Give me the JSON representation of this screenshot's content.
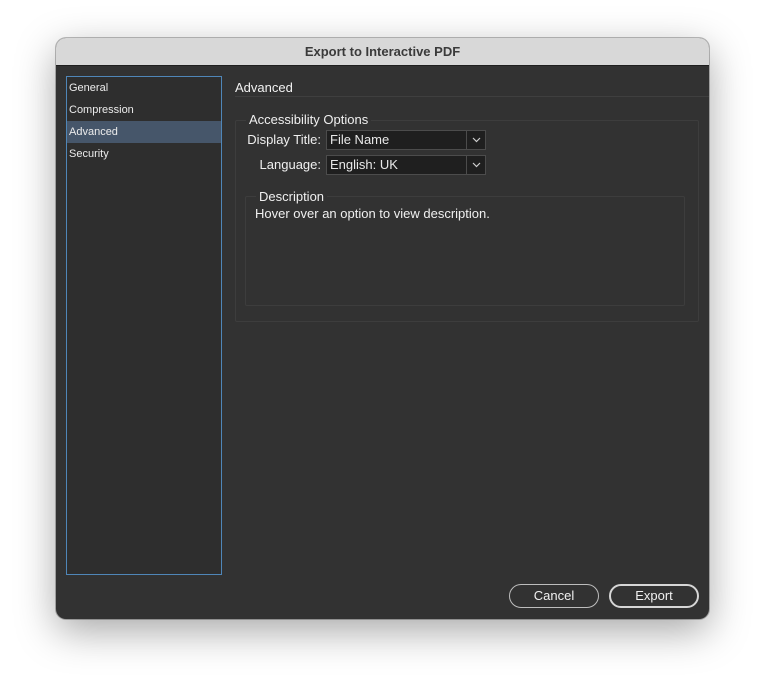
{
  "window": {
    "title": "Export to Interactive PDF"
  },
  "sidebar": {
    "items": [
      {
        "label": "General"
      },
      {
        "label": "Compression"
      },
      {
        "label": "Advanced"
      },
      {
        "label": "Security"
      }
    ],
    "selected": "Advanced"
  },
  "main": {
    "section_title": "Advanced",
    "accessibility": {
      "legend": "Accessibility Options",
      "display_title": {
        "label": "Display Title:",
        "value": "File Name"
      },
      "language": {
        "label": "Language:",
        "value": "English: UK"
      }
    },
    "description": {
      "legend": "Description",
      "text": "Hover over an option to view description."
    }
  },
  "footer": {
    "cancel_label": "Cancel",
    "export_label": "Export"
  },
  "icons": {
    "dropdown": "chevron-down-icon"
  },
  "colors": {
    "dialog_bg": "#323232",
    "titlebar_bg": "#d8d8d8",
    "sidebar_border": "#4f86b8",
    "selected_item_bg": "#46566a"
  }
}
